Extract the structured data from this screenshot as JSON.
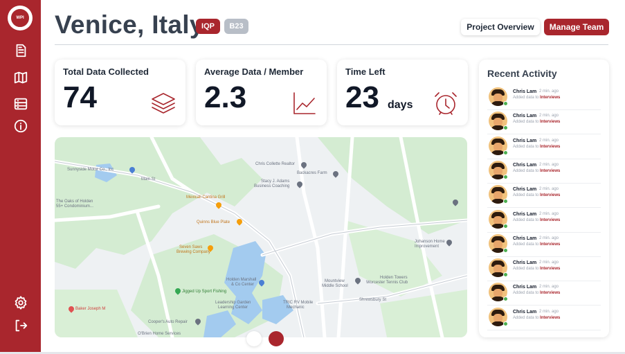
{
  "header": {
    "title": "Venice, Italy",
    "badges": [
      "IQP",
      "B23"
    ],
    "buttons": {
      "overview": "Project Overview",
      "team": "Manage Team"
    }
  },
  "sidebar": {
    "logo_text": "WPI",
    "items": [
      "document-icon",
      "map-icon",
      "database-icon",
      "info-icon"
    ],
    "bottom": [
      "settings-icon",
      "logout-icon"
    ]
  },
  "stats": [
    {
      "title": "Total Data Collected",
      "value": "74",
      "unit": "",
      "icon": "layers-icon"
    },
    {
      "title": "Average Data / Member",
      "value": "2.3",
      "unit": "",
      "icon": "line-chart-icon"
    },
    {
      "title": "Time Left",
      "value": "23",
      "unit": "days",
      "icon": "alarm-clock-icon"
    }
  ],
  "map": {
    "labels": {
      "sunnyside": "Sunnyside Motor Co., Inc",
      "chris_collette": "Chris Collette Realtor",
      "backacres": "Backacres Farm",
      "stacy": "Stacy J. Adams",
      "stacy2": "Business Coaching",
      "oaks": "The Oaks of Holden",
      "oaks2": "55+ Condominium...",
      "mexicali": "Mexicali Cantina Grill",
      "quinns": "Quinns Blue Plate",
      "seven_saws": "Seven Saws",
      "seven_saws2": "Brewing Company",
      "johanson": "Johanson Home",
      "johanson2": "Improvement",
      "holden_towers": "Holden Towers",
      "worcester_tennis": "Worcester Tennis Club",
      "mountview": "Mountview",
      "mountview2": "Middle School",
      "holden_marshal": "Holden Marshall",
      "holden_marshal2": "& Co Center",
      "jigged": "Jigged Up Sport Fishing",
      "trc": "TRIC RV Mobile",
      "trc2": "Mechanic",
      "leadership": "Leadership Garden",
      "leadership2": "Learning Center",
      "baker": "Baker Joseph M",
      "coopers": "Cooper's Auto Repair",
      "obrien": "O'Brien Home Services",
      "main_st": "Main St",
      "shrewsbury": "Shrewsbury St"
    }
  },
  "carousel": {
    "active_index": 1,
    "count": 2
  },
  "activity": {
    "title": "Recent Activity",
    "items": [
      {
        "name": "Chris Lam",
        "time": "2 min. ago",
        "desc": "Added data to",
        "link": "Interviews"
      },
      {
        "name": "Chris Lam",
        "time": "2 min. ago",
        "desc": "Added data to",
        "link": "Interviews"
      },
      {
        "name": "Chris Lam",
        "time": "2 min. ago",
        "desc": "Added data to",
        "link": "Interviews"
      },
      {
        "name": "Chris Lam",
        "time": "2 min. ago",
        "desc": "Added data to",
        "link": "Interviews"
      },
      {
        "name": "Chris Lam",
        "time": "2 min. ago",
        "desc": "Added data to",
        "link": "Interviews"
      },
      {
        "name": "Chris Lam",
        "time": "2 min. ago",
        "desc": "Added data to",
        "link": "Interviews"
      },
      {
        "name": "Chris Lam",
        "time": "2 min. ago",
        "desc": "Added data to",
        "link": "Interviews"
      },
      {
        "name": "Chris Lam",
        "time": "2 min. ago",
        "desc": "Added data to",
        "link": "Interviews"
      },
      {
        "name": "Chris Lam",
        "time": "2 min. ago",
        "desc": "Added data to",
        "link": "Interviews"
      },
      {
        "name": "Chris Lam",
        "time": "2 min. ago",
        "desc": "Added data to",
        "link": "Interviews"
      }
    ]
  },
  "colors": {
    "brand": "#a9262d",
    "badge_muted": "#b8bec7",
    "online": "#4caf50"
  }
}
